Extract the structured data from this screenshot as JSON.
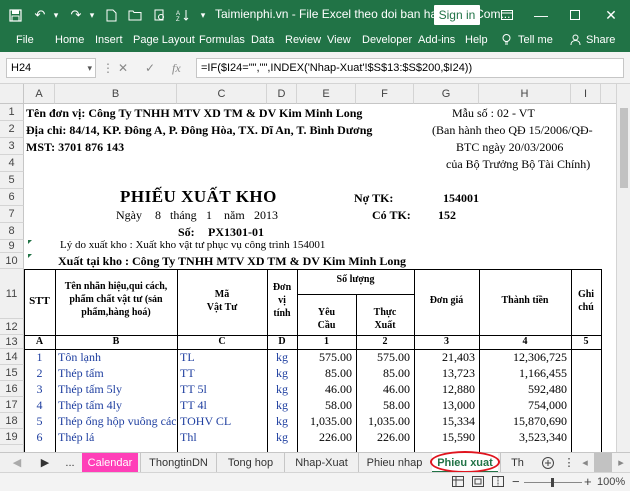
{
  "window": {
    "title": "Taimienphi.vn - File Excel theo doi ban hang.xls [Com...",
    "signin_label": "Sign in"
  },
  "ribbon": {
    "tabs": [
      "File",
      "Home",
      "Insert",
      "Page Layout",
      "Formulas",
      "Data",
      "Review",
      "View",
      "Developer",
      "Add-ins",
      "Help"
    ],
    "tellme": "Tell me",
    "share": "Share"
  },
  "formula_bar": {
    "name_box": "H24",
    "formula": "=IF($I24=\"\",\"\",INDEX('Nhap-Xuat'!$S$13:$S$200,$I24))"
  },
  "columns": [
    "A",
    "B",
    "C",
    "D",
    "E",
    "F",
    "G",
    "H",
    "I"
  ],
  "rows": [
    "1",
    "2",
    "3",
    "4",
    "5",
    "6",
    "7",
    "8",
    "9",
    "10",
    "11",
    "12",
    "13",
    "14",
    "15",
    "16",
    "17",
    "18",
    "19"
  ],
  "sheet": {
    "company": "Tên đơn vị:  Công Ty TNHH MTV XD TM & DV Kim Minh Long",
    "address": "Địa chỉ:  84/14, KP. Đông A, P. Đông Hòa, TX. Dĩ An, T. Bình Dương",
    "mst": "MST:  3701 876 143",
    "form_no": "Mẫu số :  02 -  VT",
    "decree_1": "(Ban hành theo QĐ 15/2006/QĐ-",
    "decree_2": "BTC ngày 20/03/2006",
    "decree_3": "của Bộ Trưởng Bộ Tài Chính)",
    "doc_title": "PHIẾU  XUẤT  KHO",
    "no_tk_label": "Nợ TK:",
    "no_tk_value": "154001",
    "date_ngay": "Ngày",
    "date_day": "8",
    "date_thang": "tháng",
    "date_month": "1",
    "date_nam": "năm",
    "date_year": "2013",
    "co_tk_label": "Có TK:",
    "co_tk_value": "152",
    "so_label": "Số:",
    "so_value": "PX1301-01",
    "reason": "Lý do xuất kho :    Xuất kho vật tư phục vụ công trình  154001",
    "warehouse": "Xuất tại kho : Công Ty TNHH MTV XD TM & DV Kim Minh Long"
  },
  "table": {
    "h_stt": "STT",
    "h_name": "Tên nhãn hiệu,qui cách, phẩm chất vật  tư (sản phẩm,hàng hoá)",
    "h_code": "Mã\nVật Tư",
    "h_unit": "Đơn\nvị\ntính",
    "h_qty": "Số lượng",
    "h_req": "Yêu\nCầu",
    "h_act": "Thực\nXuất",
    "h_price": "Đơn giá",
    "h_amount": "Thành  tiền",
    "h_note": "Ghi\nchú",
    "letters": [
      "A",
      "B",
      "C",
      "D",
      "1",
      "2",
      "3",
      "4",
      "5"
    ],
    "rows": [
      {
        "stt": "1",
        "name": "Tôn lạnh",
        "code": "TL",
        "unit": "kg",
        "req": "575.00",
        "act": "575.00",
        "price": "21,403",
        "amount": "12,306,725"
      },
      {
        "stt": "2",
        "name": "Thép tấm",
        "code": "TT",
        "unit": "kg",
        "req": "85.00",
        "act": "85.00",
        "price": "13,723",
        "amount": "1,166,455"
      },
      {
        "stt": "3",
        "name": "Thép tấm 5ly",
        "code": "TT 5l",
        "unit": "kg",
        "req": "46.00",
        "act": "46.00",
        "price": "12,880",
        "amount": "592,480"
      },
      {
        "stt": "4",
        "name": "Thép tấm  4ly",
        "code": "TT 4l",
        "unit": "kg",
        "req": "58.00",
        "act": "58.00",
        "price": "13,000",
        "amount": "754,000"
      },
      {
        "stt": "5",
        "name": "Thép ống hộp vuông các lo",
        "code": "TOHV CL",
        "unit": "kg",
        "req": "1,035.00",
        "act": "1,035.00",
        "price": "15,334",
        "amount": "15,870,690"
      },
      {
        "stt": "6",
        "name": "Thép lá",
        "code": "Thl",
        "unit": "kg",
        "req": "226.00",
        "act": "226.00",
        "price": "15,590",
        "amount": "3,523,340"
      }
    ]
  },
  "sheet_tabs": [
    "Calendar",
    "ThongtinDN",
    "Tong hop",
    "Nhap-Xuat",
    "Phieu nhap",
    "Phieu xuat",
    "Th"
  ],
  "status": {
    "zoom": "100%"
  }
}
